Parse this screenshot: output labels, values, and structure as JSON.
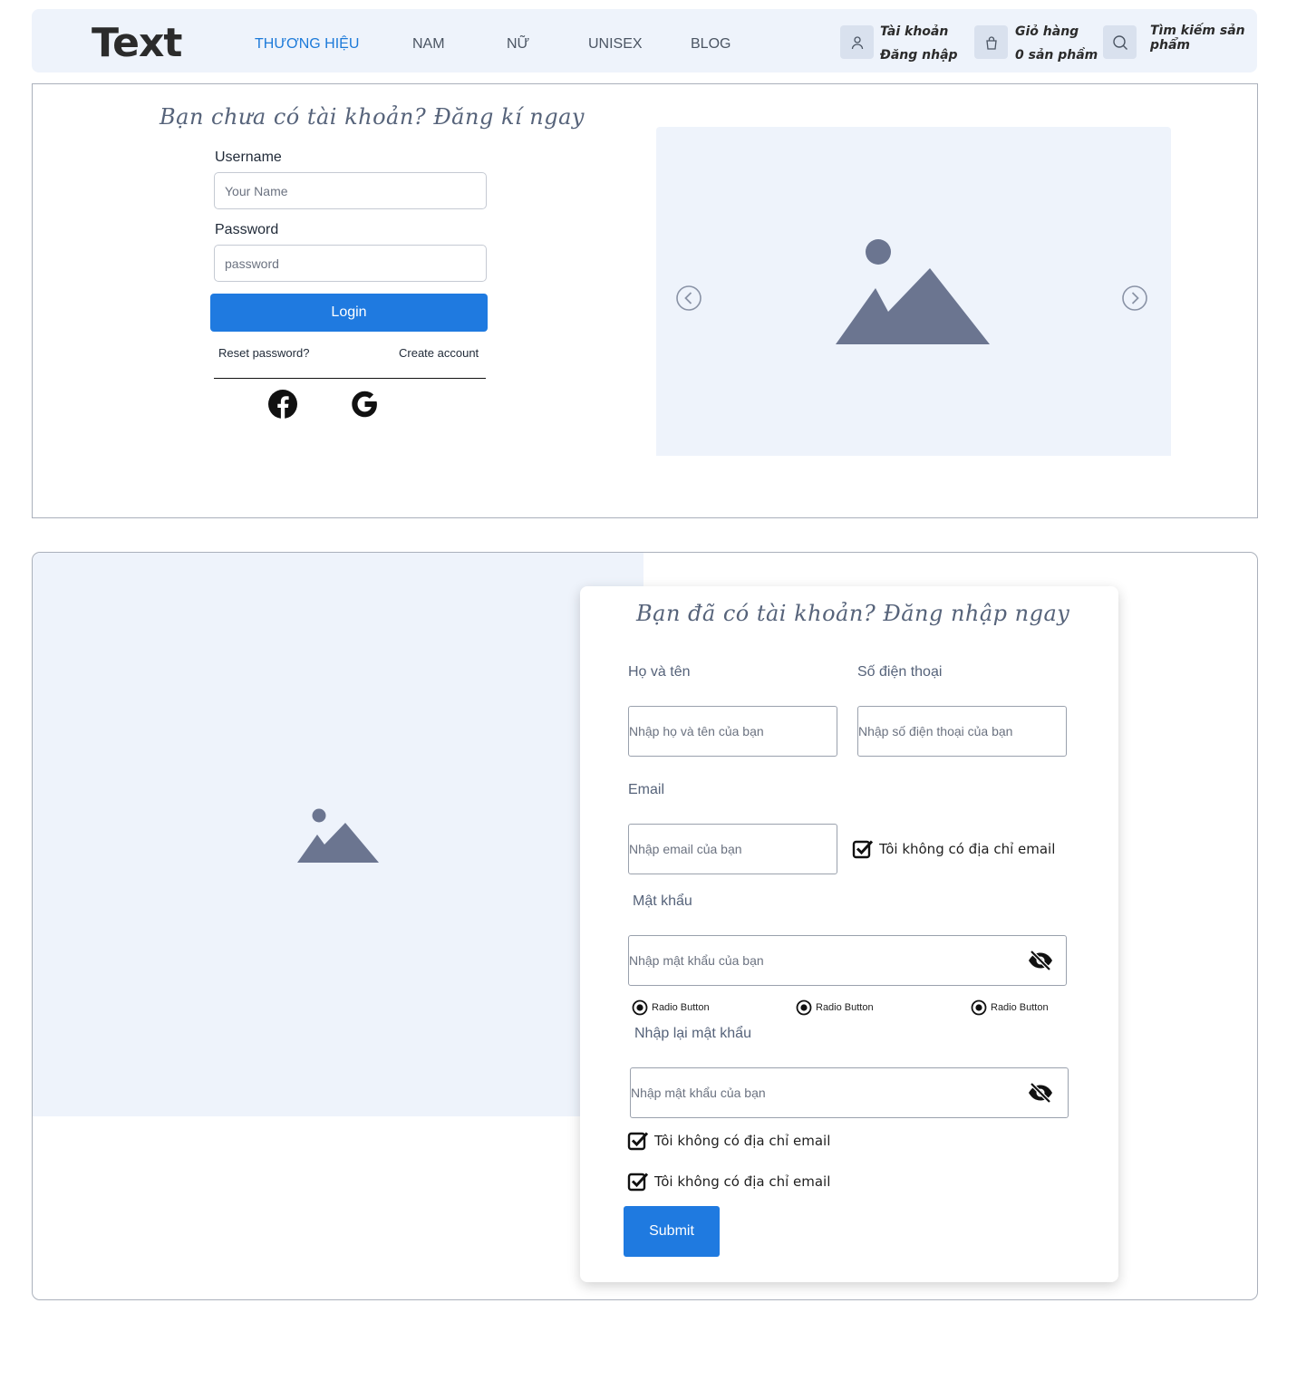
{
  "header": {
    "logo": "Text",
    "nav": [
      "THƯƠNG HIỆU",
      "NAM",
      "NỮ",
      "UNISEX",
      "BLOG"
    ],
    "active_nav": "THƯƠNG HIỆU",
    "account": {
      "line1": "Tài khoản",
      "line2": "Đăng nhập",
      "icon": "user-icon"
    },
    "cart": {
      "line1": "Giỏ hàng",
      "line2": "0 sản phầm",
      "icon": "shopping-bag-icon"
    },
    "search": {
      "line1": "Tìm kiếm sản",
      "line2": "phẩm",
      "icon": "search-icon"
    }
  },
  "login": {
    "title": "Bạn chưa có tài khoản? Đăng kí ngay",
    "username_label": "Username",
    "username_placeholder": "Your Name",
    "password_label": "Password",
    "password_placeholder": "password",
    "login_button": "Login",
    "reset_link": "Reset password?",
    "create_link": "Create account",
    "social": [
      "facebook-icon",
      "google-icon"
    ]
  },
  "register": {
    "title": "Bạn đã có tài khoản? Đăng nhập ngay",
    "fullname_label": "Họ và tên",
    "fullname_placeholder": "Nhập họ và tên của bạn",
    "phone_label": "Số điện thoại",
    "phone_placeholder": "Nhập số điện thoại của bạn",
    "email_label": "Email",
    "email_placeholder": "Nhập email của bạn",
    "no_email_check": "Tôi không có địa chỉ email",
    "password_label": "Mật khẩu",
    "password_placeholder": "Nhập mật khẩu của bạn",
    "radios": [
      "Radio Button",
      "Radio Button",
      "Radio Button"
    ],
    "confirm_label": "Nhập lại mật khẩu",
    "confirm_placeholder": "Nhập mật khẩu của bạn",
    "check1": "Tôi không có địa chỉ email",
    "check2": "Tôi không có địa chỉ email",
    "submit_button": "Submit"
  },
  "colors": {
    "accent": "#1f7ae0",
    "header_bg": "#eef3fb",
    "placeholder_image_bg": "#eef3fb",
    "image_glyph": "#6b7590"
  }
}
